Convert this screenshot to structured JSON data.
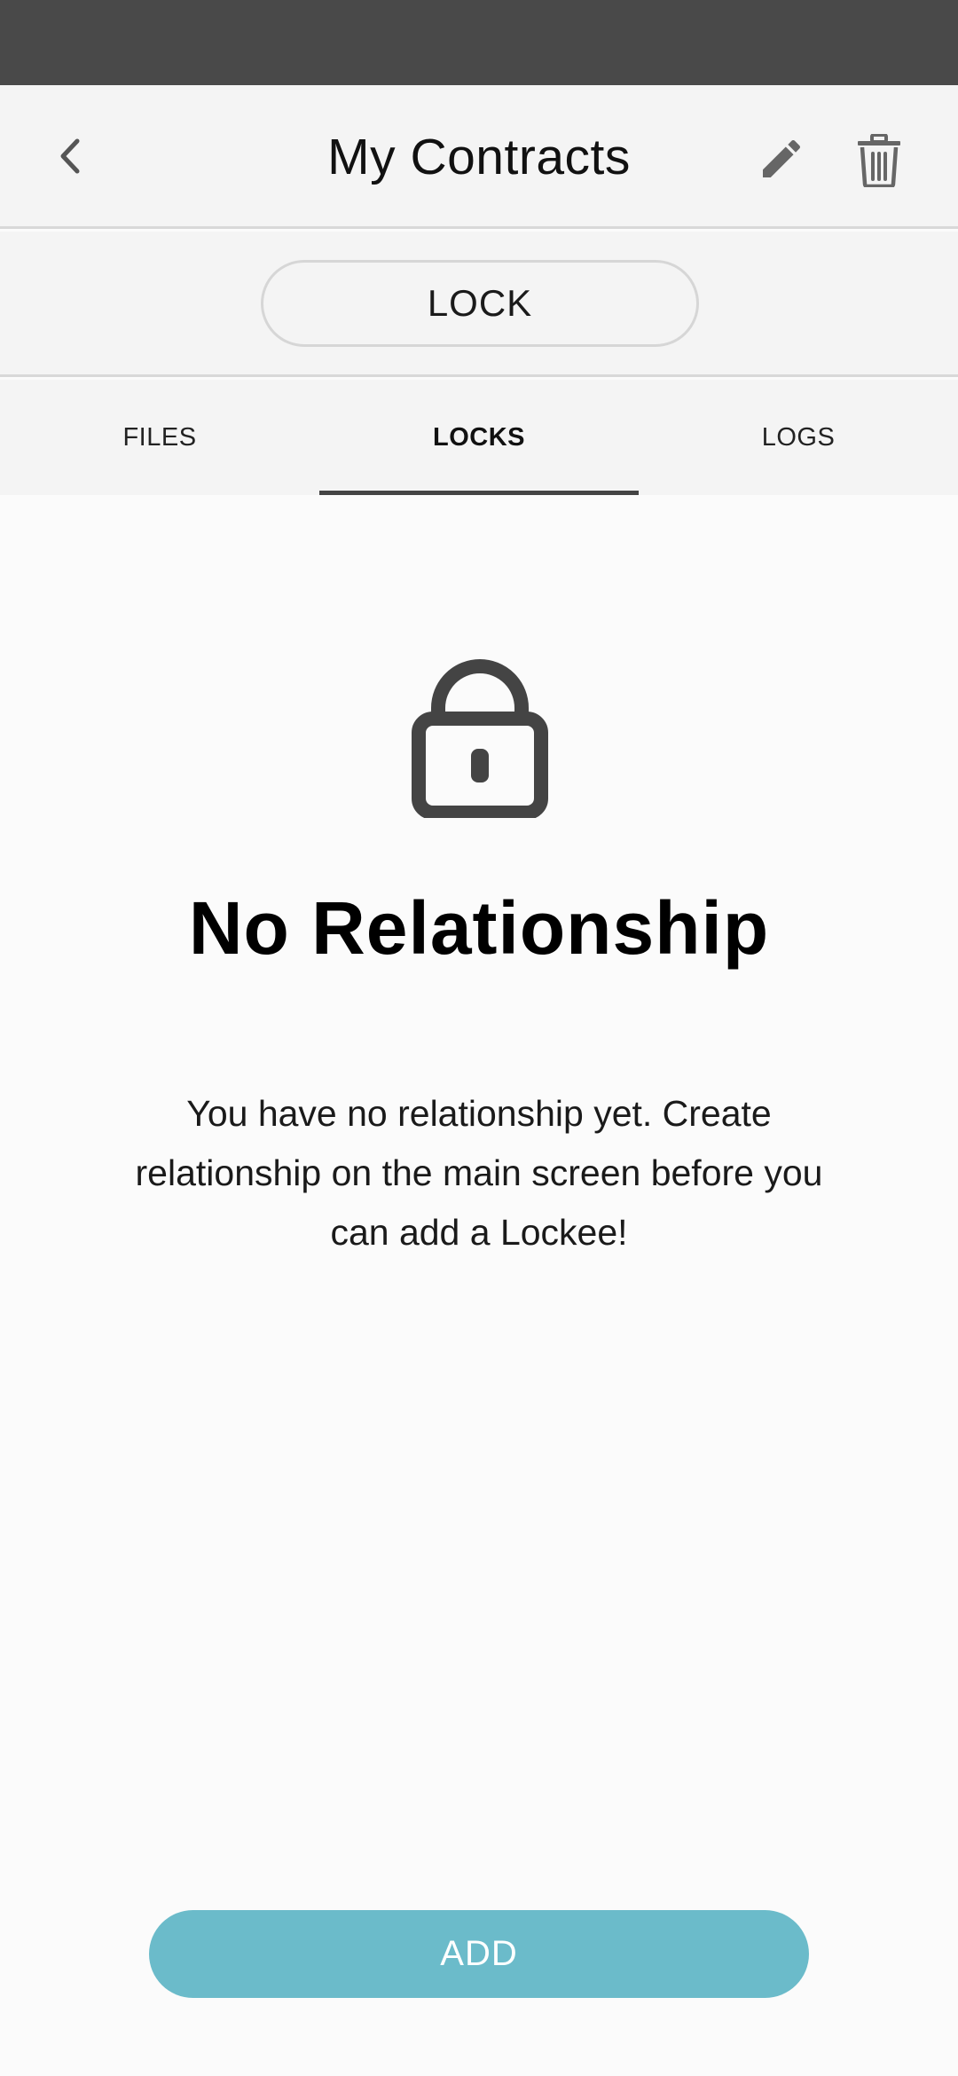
{
  "header": {
    "title": "My Contracts"
  },
  "lock_button": {
    "label": "LOCK"
  },
  "tabs": [
    {
      "label": "FILES",
      "active": false
    },
    {
      "label": "LOCKS",
      "active": true
    },
    {
      "label": "LOGS",
      "active": false
    }
  ],
  "empty_state": {
    "heading": "No Relationship",
    "message": "You have no relationship yet. Create relationship on the main screen before you can add a Lockee!"
  },
  "add_button": {
    "label": "ADD"
  },
  "colors": {
    "status_bar": "#494949",
    "accent": "#6bbbca",
    "icon": "#444444"
  },
  "icons": {
    "back": "chevron-left-icon",
    "edit": "pencil-icon",
    "delete": "trash-icon",
    "empty": "lock-icon"
  }
}
